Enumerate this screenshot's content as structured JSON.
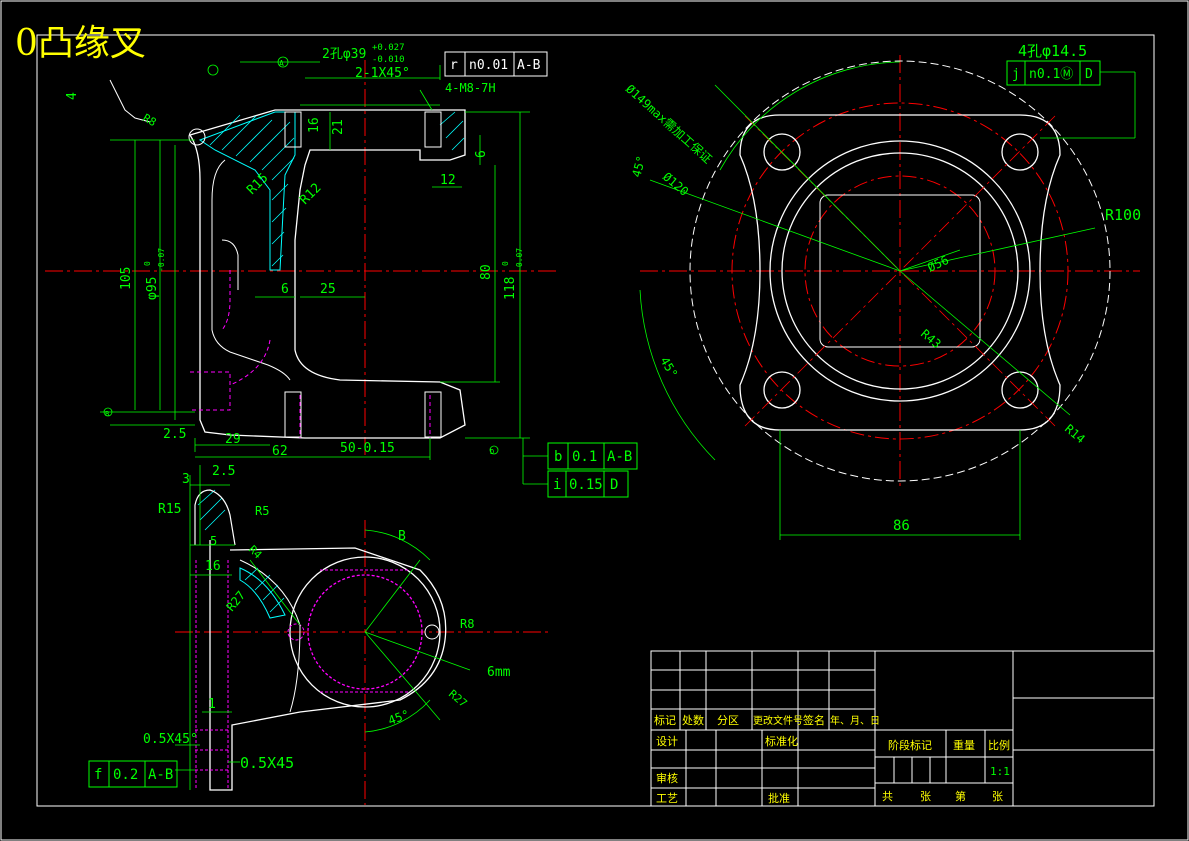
{
  "title": "0凸缘叉",
  "colors": {
    "background": "#000000",
    "outline": "#ffffff",
    "dimension": "#00ff00",
    "centerline": "#ff0000",
    "hidden": "#ff00ff",
    "hatch": "#00ffff",
    "title_text": "#ffff00"
  },
  "front_view": {
    "dims": {
      "holes_dia": "2孔φ39",
      "holes_tol_upper": "+0.027",
      "holes_tol_lower": "-0.010",
      "chamfer": "2-1X45°",
      "thread": "4-M8-7H",
      "d16": "16",
      "d21": "21",
      "d6_right": "6",
      "d12": "12",
      "r15": "R15",
      "r12": "R12",
      "d105": "105",
      "phi95": "φ95",
      "phi95_tol_upper": "0",
      "phi95_tol_lower": "-0.07",
      "d80": "80",
      "d118": "118",
      "d118_tol_upper": "0",
      "d118_tol_lower": "-0.07",
      "d6_left": "6",
      "d25": "25",
      "d2_5": "2.5",
      "d29": "29",
      "d62": "62",
      "d50": "50-0.15",
      "d4": "4",
      "rs8": "R8"
    },
    "fcf_top": {
      "symbol": "r",
      "tol": "n0.01",
      "datum": "A-B"
    },
    "fcf_b": {
      "symbol": "b",
      "tol": "0.1",
      "datum": "A-B"
    },
    "fcf_i": {
      "symbol": "i",
      "tol": "0.15",
      "datum": "D"
    },
    "datum_a": "A",
    "datum_b": "B",
    "datum_d": "D"
  },
  "side_view": {
    "dims": {
      "holes": "4孔φ14.5",
      "diag": "Ø149max需加工保证",
      "phi120": "Ø120",
      "angle_top": "45°",
      "angle_bot": "45°",
      "phi56": "Ø56",
      "r100": "R100",
      "r43": "R43",
      "r14": "R14",
      "d86": "86"
    },
    "fcf": {
      "symbol": "j",
      "tol": "n0.1Ⓜ",
      "datum": "D"
    }
  },
  "section_view": {
    "dims": {
      "d3": "3",
      "d2_5": "2.5",
      "r15": "R15",
      "r5": "R5",
      "d5": "5",
      "r4": "R4",
      "d16": "16",
      "r27_left": "R27",
      "b": "B",
      "r8": "R8",
      "mm6": "6mm",
      "r27_right": "R27",
      "angle": "45°",
      "d1": "1",
      "chamfer_left": "0.5X45°",
      "chamfer_right": "0.5X45"
    },
    "fcf": {
      "symbol": "f",
      "tol": "0.2",
      "datum": "A-B"
    }
  },
  "title_block": {
    "row_labels": [
      "标记",
      "处数",
      "分区",
      "更改文件号",
      "签名",
      "年、月、日"
    ],
    "design": "设计",
    "standard": "标准化",
    "review": "审核",
    "process": "工艺",
    "approve": "批准",
    "stage": "阶段标记",
    "weight": "重量",
    "scale": "比例",
    "scale_value": "1:1",
    "total": "共",
    "sheets": "张",
    "page": "第",
    "sheet2": "张"
  }
}
